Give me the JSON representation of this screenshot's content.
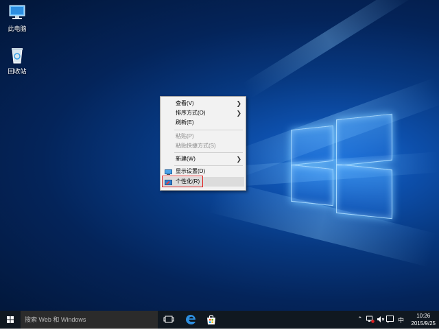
{
  "desktop": {
    "icons": [
      {
        "label": "此电脑",
        "icon": "computer-icon"
      },
      {
        "label": "回收站",
        "icon": "recycle-bin-icon"
      }
    ]
  },
  "context_menu": {
    "items": [
      {
        "label": "查看(V)",
        "submenu": true,
        "enabled": true
      },
      {
        "label": "排序方式(O)",
        "submenu": true,
        "enabled": true
      },
      {
        "label": "刷新(E)",
        "submenu": false,
        "enabled": true
      },
      {
        "label": "粘贴(P)",
        "submenu": false,
        "enabled": false
      },
      {
        "label": "粘贴快捷方式(S)",
        "submenu": false,
        "enabled": false
      },
      {
        "label": "新建(W)",
        "submenu": true,
        "enabled": true
      },
      {
        "label": "显示设置(D)",
        "submenu": false,
        "enabled": true,
        "icon": "display-icon"
      },
      {
        "label": "个性化(R)",
        "submenu": false,
        "enabled": true,
        "icon": "personalize-icon",
        "highlighted": true
      }
    ],
    "highlight_color": "#e02020"
  },
  "taskbar": {
    "search_placeholder": "搜索 Web 和 Windows",
    "pinned": [
      "task-view-icon",
      "edge-icon",
      "store-icon"
    ],
    "tray": {
      "ime": "中",
      "time": "10:26",
      "date": "2015/9/25"
    }
  },
  "colors": {
    "accent": "#1a6fd6",
    "taskbar": "#101820"
  }
}
